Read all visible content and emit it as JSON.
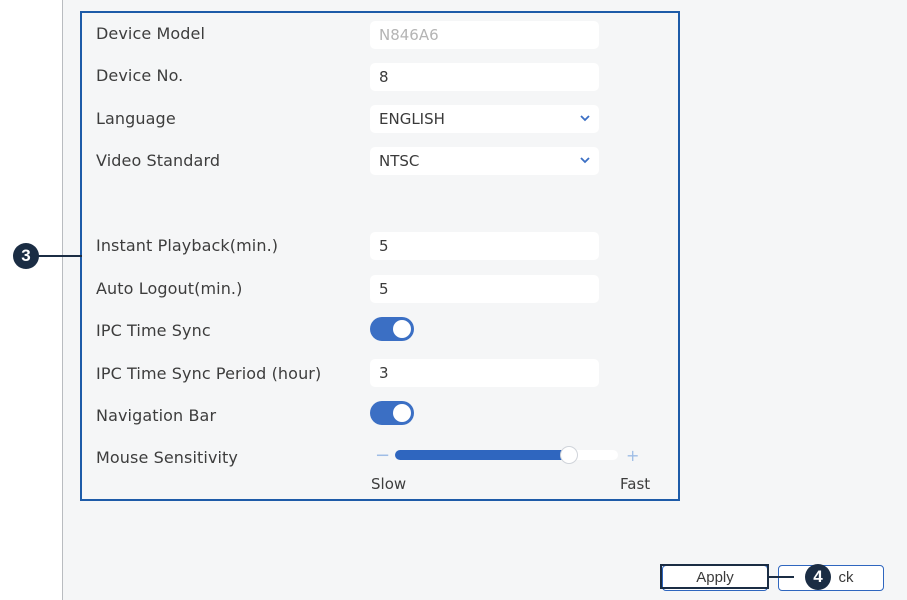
{
  "settings": {
    "device_model": {
      "label": "Device Model",
      "value": "N846A6"
    },
    "device_no": {
      "label": "Device No.",
      "value": "8"
    },
    "language": {
      "label": "Language",
      "value": "ENGLISH"
    },
    "video_standard": {
      "label": "Video Standard",
      "value": "NTSC"
    },
    "instant_playback": {
      "label": "Instant Playback(min.)",
      "value": "5"
    },
    "auto_logout": {
      "label": "Auto Logout(min.)",
      "value": "5"
    },
    "ipc_time_sync": {
      "label": "IPC Time Sync",
      "enabled": true
    },
    "ipc_time_sync_period": {
      "label": "IPC Time Sync Period (hour)",
      "value": "3"
    },
    "navigation_bar": {
      "label": "Navigation Bar",
      "enabled": true
    },
    "mouse_sensitivity": {
      "label": "Mouse Sensitivity",
      "level_fraction": 0.78,
      "min_symbol": "−",
      "max_symbol": "+",
      "min_caption": "Slow",
      "max_caption": "Fast"
    }
  },
  "callouts": {
    "settings_area": "3",
    "apply_button": "4"
  },
  "buttons": {
    "apply": "Apply",
    "back": "ck"
  },
  "colors": {
    "accent": "#2f66bf",
    "callout": "#1b2d44",
    "highlight": "#1d5ba8"
  },
  "icons": {
    "dropdown": "chevron-down-icon"
  }
}
